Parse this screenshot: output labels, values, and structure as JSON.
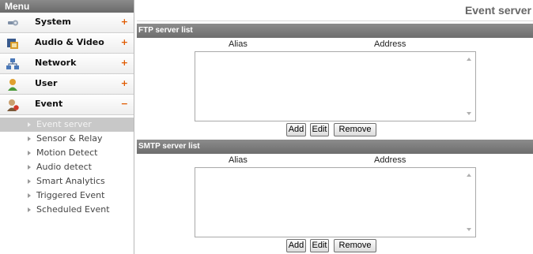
{
  "sidebar": {
    "header": "Menu",
    "items": [
      {
        "label": "System",
        "sign": "+",
        "icon": "wrench-icon"
      },
      {
        "label": "Audio & Video",
        "sign": "+",
        "icon": "film-icon"
      },
      {
        "label": "Network",
        "sign": "+",
        "icon": "network-icon"
      },
      {
        "label": "User",
        "sign": "+",
        "icon": "user-icon"
      },
      {
        "label": "Event",
        "sign": "−",
        "icon": "event-user-icon"
      }
    ],
    "subitems": [
      {
        "label": "Event server",
        "active": true
      },
      {
        "label": "Sensor & Relay"
      },
      {
        "label": "Motion Detect"
      },
      {
        "label": "Audio detect"
      },
      {
        "label": "Smart Analytics"
      },
      {
        "label": "Triggered Event"
      },
      {
        "label": "Scheduled Event"
      }
    ]
  },
  "main": {
    "title": "Event server",
    "ftp": {
      "header": "FTP server list",
      "col_alias": "Alias",
      "col_address": "Address",
      "buttons": {
        "add": "Add",
        "edit": "Edit",
        "remove": "Remove"
      }
    },
    "smtp": {
      "header": "SMTP server list",
      "col_alias": "Alias",
      "col_address": "Address",
      "buttons": {
        "add": "Add",
        "edit": "Edit",
        "remove": "Remove"
      }
    }
  }
}
